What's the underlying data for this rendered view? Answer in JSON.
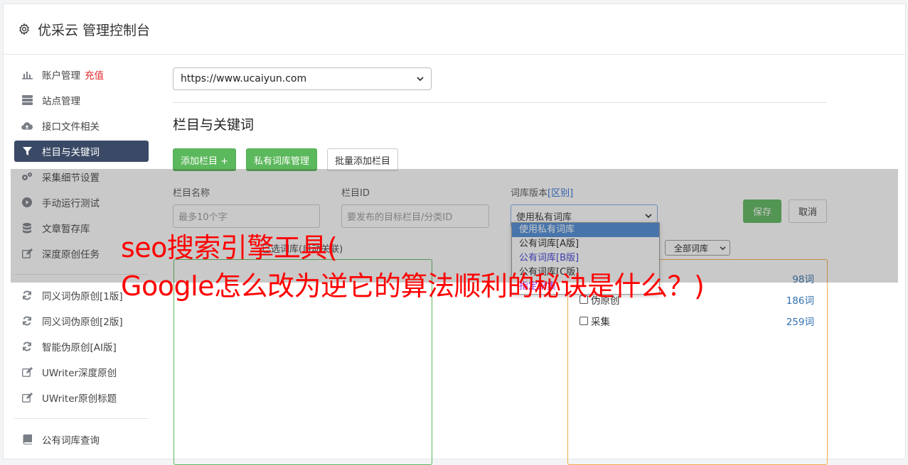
{
  "header": {
    "title": "优采云 管理控制台"
  },
  "sidebar": {
    "items": [
      {
        "label": "账户管理",
        "extra": "充值",
        "icon": "bar-chart-icon"
      },
      {
        "label": "站点管理",
        "icon": "server-icon"
      },
      {
        "label": "接口文件相关",
        "icon": "cloud-upload-icon"
      },
      {
        "label": "栏目与关键词",
        "icon": "filter-icon",
        "active": true
      },
      {
        "label": "采集细节设置",
        "icon": "gears-icon"
      },
      {
        "label": "手动运行测试",
        "icon": "play-circle-icon"
      },
      {
        "label": "文章暂存库",
        "icon": "database-icon"
      },
      {
        "label": "深度原创任务",
        "icon": "edit-icon"
      },
      {
        "label": "同义词伪原创[1版]",
        "icon": "refresh-icon"
      },
      {
        "label": "同义词伪原创[2版]",
        "icon": "refresh-icon"
      },
      {
        "label": "智能伪原创[AI版]",
        "icon": "refresh-icon"
      },
      {
        "label": "UWriter深度原创",
        "icon": "edit-icon"
      },
      {
        "label": "UWriter原创标题",
        "icon": "edit-icon"
      },
      {
        "label": "公有词库查询",
        "icon": "book-icon"
      }
    ]
  },
  "main": {
    "site_select": "https://www.ucaiyun.com",
    "section_title": "栏目与关键词",
    "buttons": {
      "add_column": "添加栏目 +",
      "private_lib": "私有词库管理",
      "batch_add": "批量添加栏目"
    },
    "form": {
      "name_label": "栏目名称",
      "name_placeholder": "最多10个字",
      "id_label": "栏目ID",
      "id_placeholder": "要发布的目标栏目/分类ID",
      "version_label": "词库版本",
      "version_link": "[区别]",
      "version_value": "使用私有词库",
      "save": "保存",
      "cancel": "取消"
    },
    "dropdown_options": [
      "使用私有词库",
      "公有词库[A版]",
      "公有词库[B版]",
      "公有词库[C版]",
      "指定采集"
    ],
    "library": {
      "left_label": "已选词库(自动关联)",
      "filter": "全部词库",
      "rows": [
        {
          "name": "",
          "count": "98词"
        },
        {
          "name": "伪原创",
          "count": "186词"
        },
        {
          "name": "采集",
          "count": "259词"
        }
      ]
    }
  },
  "overlay": {
    "line1": "seo搜索引擎工具(",
    "line2": "Google怎么改为逆它的算法顺利的秘诀是什么？)"
  },
  "colors": {
    "accent_green": "#5cb85c",
    "active_nav": "#3a4a66",
    "headline_red": "#ff0000",
    "recharge_red": "#e0262a"
  }
}
